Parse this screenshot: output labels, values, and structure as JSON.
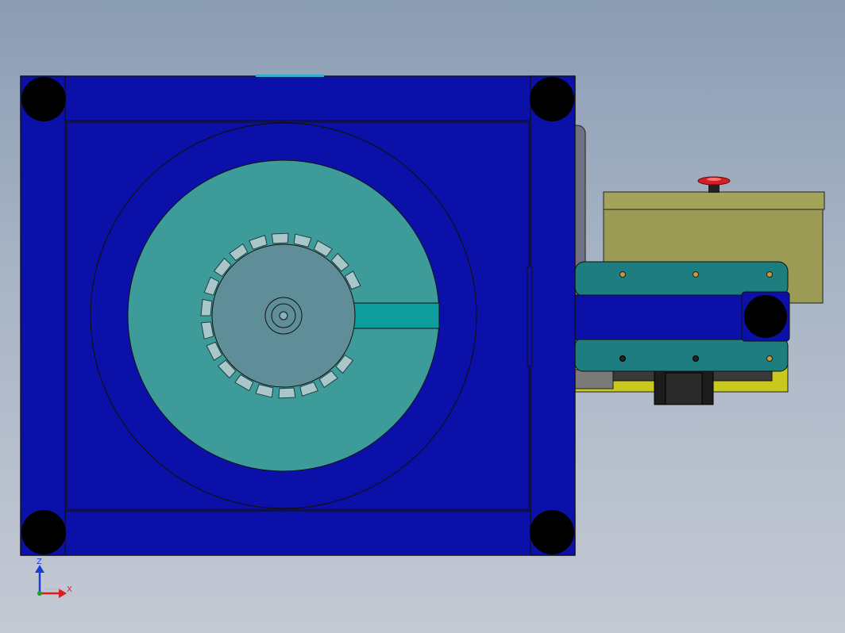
{
  "viewport": {
    "background_top": "#8b9db4",
    "background_bottom": "#c4c9d4"
  },
  "colors": {
    "frame_blue": "#0a10a8",
    "frame_blue_dark": "#06088a",
    "hopper_teal": "#3d9c9a",
    "bowl_grey": "#5f8d98",
    "track_teal": "#0e9c9c",
    "conveyor_teal": "#1e7d7e",
    "controller_olive": "#9b9b55",
    "controller_top": "#a4a35c",
    "stop_button_red": "#d0202a",
    "foot_black": "#000000"
  },
  "triad": {
    "z_label": "Z",
    "x_label": "X"
  }
}
